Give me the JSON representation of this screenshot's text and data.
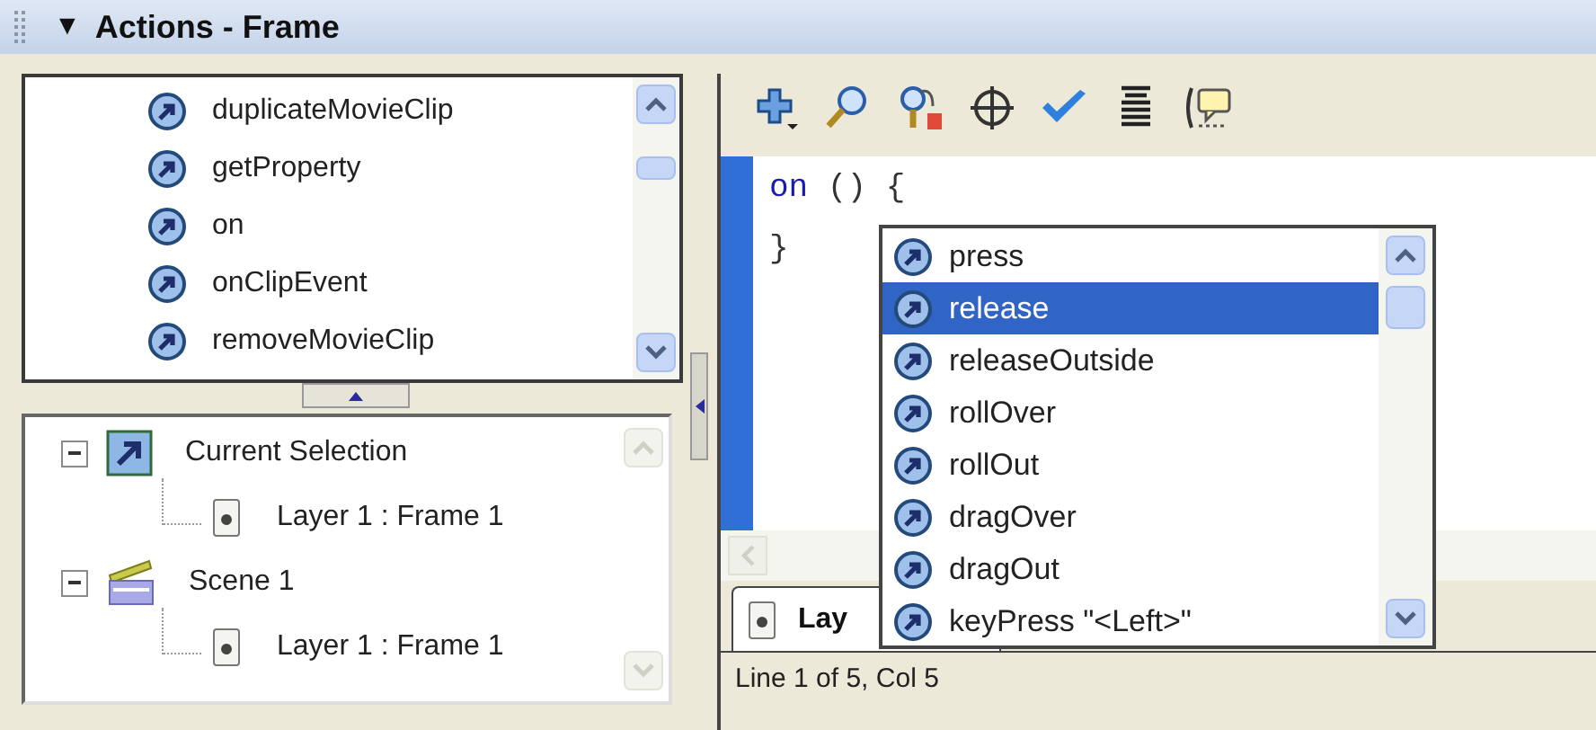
{
  "window": {
    "collapse_glyph": "▼",
    "title": "Actions - Frame"
  },
  "actions_list": {
    "items": [
      "duplicateMovieClip",
      "getProperty",
      "on",
      "onClipEvent",
      "removeMovieClip"
    ]
  },
  "script_navigator": {
    "items": [
      {
        "label": "Current Selection",
        "kind": "selection",
        "expanded": true,
        "children": [
          {
            "label": "Layer 1 : Frame 1",
            "kind": "frame"
          }
        ]
      },
      {
        "label": "Scene 1",
        "kind": "scene",
        "expanded": true,
        "children": [
          {
            "label": "Layer 1 : Frame 1",
            "kind": "frame"
          }
        ]
      }
    ]
  },
  "editor": {
    "lines": [
      [
        {
          "text": "on",
          "kind": "keyword"
        },
        {
          "text": " () {",
          "kind": "plain"
        }
      ],
      [
        {
          "text": "}",
          "kind": "plain"
        }
      ]
    ]
  },
  "script_tab": {
    "label": "Lay",
    "selected": true
  },
  "code_hints": [
    {
      "label": "press",
      "selected": false
    },
    {
      "label": "release",
      "selected": true
    },
    {
      "label": "releaseOutside",
      "selected": false
    },
    {
      "label": "rollOver",
      "selected": false
    },
    {
      "label": "rollOut",
      "selected": false
    },
    {
      "label": "dragOver",
      "selected": false
    },
    {
      "label": "dragOut",
      "selected": false
    },
    {
      "label": "keyPress \"<Left>\"",
      "selected": false
    }
  ],
  "status_bar": "Line 1 of 5, Col 5"
}
